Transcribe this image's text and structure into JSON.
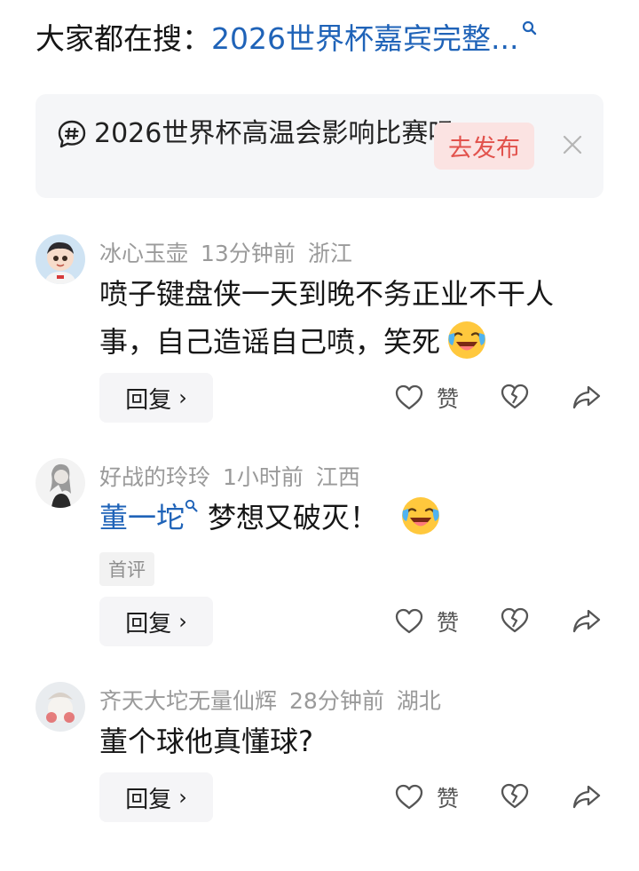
{
  "search": {
    "prefix": "大家都在搜：",
    "link": "2026世界杯嘉宾完整..."
  },
  "topic": {
    "text": "2026世界杯高温会影响比赛吗",
    "publish_label": "去发布"
  },
  "comments": [
    {
      "user": "冰心玉壶",
      "time": "13分钟前",
      "location": "浙江",
      "text": "喷子键盘侠一天到晚不务正业不干人事，自己造谣自己喷，笑死",
      "reply_label": "回复",
      "like_label": "赞"
    },
    {
      "user": "好战的玲玲",
      "time": "1小时前",
      "location": "江西",
      "mention": "董一坨",
      "text": "梦想又破灭！",
      "badge": "首评",
      "reply_label": "回复",
      "like_label": "赞"
    },
    {
      "user": "齐天大坨无量仙辉",
      "time": "28分钟前",
      "location": "湖北",
      "text": "董个球他真懂球?",
      "reply_label": "回复",
      "like_label": "赞"
    }
  ],
  "colors": {
    "link": "#1f63b8",
    "publish_bg": "#fbe3e2",
    "publish_text": "#e2524c",
    "meta": "#9a9a9a"
  }
}
